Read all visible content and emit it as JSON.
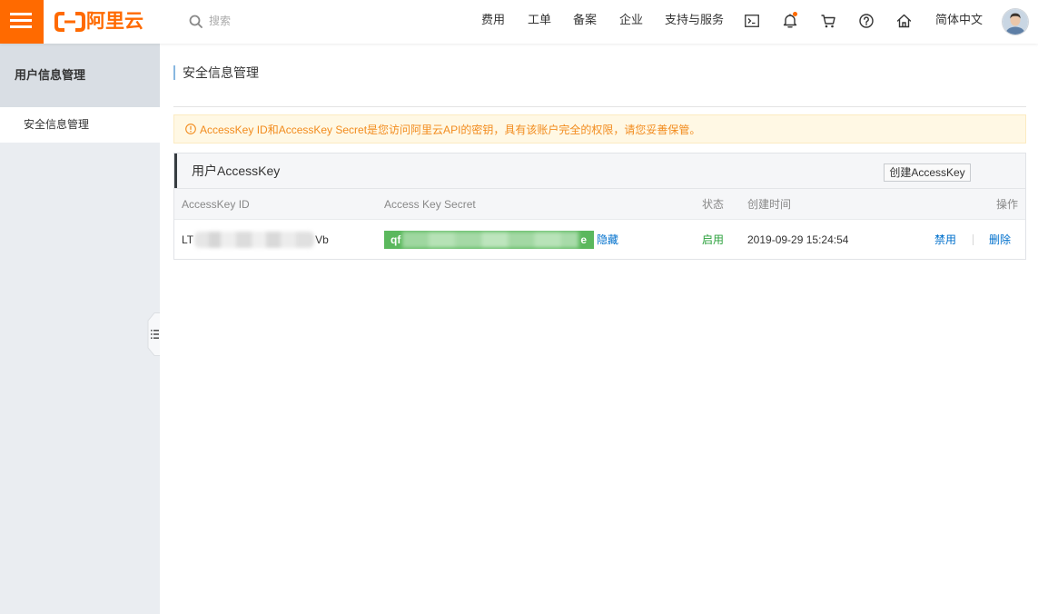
{
  "theme": {
    "brand_color": "#FF6A00",
    "link_color": "#0070CC",
    "success_color": "#2BA13C",
    "warning_color": "#F28B1D",
    "secret_badge_color": "#5BB85D"
  },
  "app": {
    "logo_text": "阿里云",
    "logo_icon": "aliyun-bracket-logo-icon",
    "menu_icon": "hamburger-icon"
  },
  "header": {
    "search": {
      "icon": "search-icon",
      "placeholder": "搜索"
    },
    "nav": [
      {
        "label": "费用"
      },
      {
        "label": "工单"
      },
      {
        "label": "备案"
      },
      {
        "label": "企业"
      },
      {
        "label": "支持与服务"
      }
    ],
    "tools": [
      {
        "icon": "terminal-icon"
      },
      {
        "icon": "bell-icon",
        "has_notification": true
      },
      {
        "icon": "cart-icon"
      },
      {
        "icon": "help-icon"
      },
      {
        "icon": "home-icon"
      }
    ],
    "language": "简体中文",
    "avatar_icon": "user-avatar-icon"
  },
  "sidebar": {
    "section_title": "用户信息管理",
    "items": [
      {
        "label": "安全信息管理",
        "active": true
      }
    ],
    "collapse_icon": "list-collapse-icon"
  },
  "main": {
    "page_title": "安全信息管理",
    "alert": {
      "icon": "exclamation-circle-icon",
      "text": "AccessKey ID和AccessKey Secret是您访问阿里云API的密钥，具有该账户完全的权限，请您妥善保管。"
    },
    "panel": {
      "title": "用户AccessKey",
      "create_button": "创建AccessKey",
      "columns": [
        "AccessKey ID",
        "Access Key Secret",
        "状态",
        "创建时间",
        "操作"
      ],
      "rows": [
        {
          "access_key_id": {
            "visible_prefix": "LT",
            "visible_suffix": "Vb",
            "obscured": true
          },
          "access_key_secret": {
            "visible_prefix": "qf",
            "visible_suffix": "e",
            "obscured": true
          },
          "secret_toggle": "隐藏",
          "status": "启用",
          "created_at": "2019-09-29 15:24:54",
          "actions": [
            "禁用",
            "删除"
          ]
        }
      ]
    }
  }
}
